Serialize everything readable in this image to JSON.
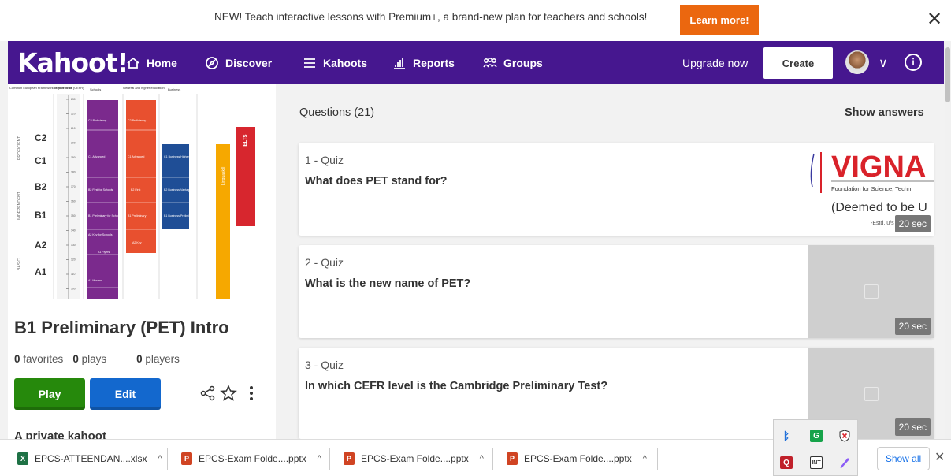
{
  "banner": {
    "text": "NEW! Teach interactive lessons with Premium+, a brand-new plan for teachers and schools!",
    "button": "Learn more!",
    "close": "✕"
  },
  "nav": {
    "logo": "Kahoot!",
    "items": [
      {
        "label": "Home",
        "icon": "home-icon"
      },
      {
        "label": "Discover",
        "icon": "compass-icon"
      },
      {
        "label": "Kahoots",
        "icon": "list-icon"
      },
      {
        "label": "Reports",
        "icon": "bar-chart-icon"
      },
      {
        "label": "Groups",
        "icon": "group-icon"
      }
    ],
    "upgrade": "Upgrade now",
    "create": "Create",
    "chevron": "∨",
    "info": "i"
  },
  "kahoot": {
    "title": "B1 Preliminary (PET) Intro",
    "favorites_count": "0",
    "favorites_label": "favorites",
    "plays_count": "0",
    "plays_label": "plays",
    "players_count": "0",
    "players_label": "players",
    "play": "Play",
    "edit": "Edit",
    "private": "A private kahoot"
  },
  "cefr_image": {
    "headers": [
      "Common European Framework of Reference (CEFR)",
      "English Scale",
      "Schools",
      "General and higher education",
      "Business"
    ],
    "levels": [
      "C2",
      "C1",
      "B2",
      "B1",
      "A2",
      "A1"
    ],
    "bands": [
      "PROFICIENT",
      "INDEPENDENT",
      "BASIC"
    ],
    "scale": [
      "230",
      "220",
      "210",
      "200",
      "190",
      "180",
      "170",
      "160",
      "150",
      "140",
      "130",
      "120",
      "110",
      "100"
    ],
    "schools": [
      "C2 Proficiency",
      "C1 Advanced",
      "B2 First for Schools",
      "B1 Preliminary for Schools",
      "A2 Key for Schools",
      "A1 Flyers",
      "A1 Movers"
    ],
    "general": [
      "C2 Proficiency",
      "C1 Advanced",
      "B2 First",
      "B1 Preliminary",
      "A2 Key"
    ],
    "business": [
      "C1 Business Higher",
      "B2 Business Vantage",
      "B1 Business Preliminary"
    ],
    "linguaskill": "Linguaskill",
    "ielts": "IELTS"
  },
  "questions": {
    "header": "Questions (21)",
    "show_answers": "Show answers",
    "items": [
      {
        "num": "1 - Quiz",
        "text": "What does PET stand for?",
        "time": "20 sec",
        "logo": {
          "name": "VIGNA",
          "line1": "Foundation for Science, Techn",
          "line2": "(Deemed to be U",
          "line3": "-Estd. u/s 3 of UGC Ac"
        }
      },
      {
        "num": "2 - Quiz",
        "text": "What is the new name of PET?",
        "time": "20 sec"
      },
      {
        "num": "3 - Quiz",
        "text": "In which CEFR level is the Cambridge Preliminary Test?",
        "time": "20 sec"
      }
    ]
  },
  "downloads": {
    "items": [
      {
        "name": "EPCS-ATTEENDAN....xlsx",
        "type": "xlsx"
      },
      {
        "name": "EPCS-Exam Folde....pptx",
        "type": "pptx"
      },
      {
        "name": "EPCS-Exam Folde....pptx",
        "type": "pptx"
      },
      {
        "name": "EPCS-Exam Folde....pptx",
        "type": "pptx"
      }
    ],
    "caret": "^",
    "show_all": "Show all",
    "close": "✕"
  },
  "colors": {
    "kahoot_purple": "#46178f",
    "play_green": "#26890c",
    "edit_blue": "#1368ce",
    "banner_orange": "#eb670f"
  }
}
